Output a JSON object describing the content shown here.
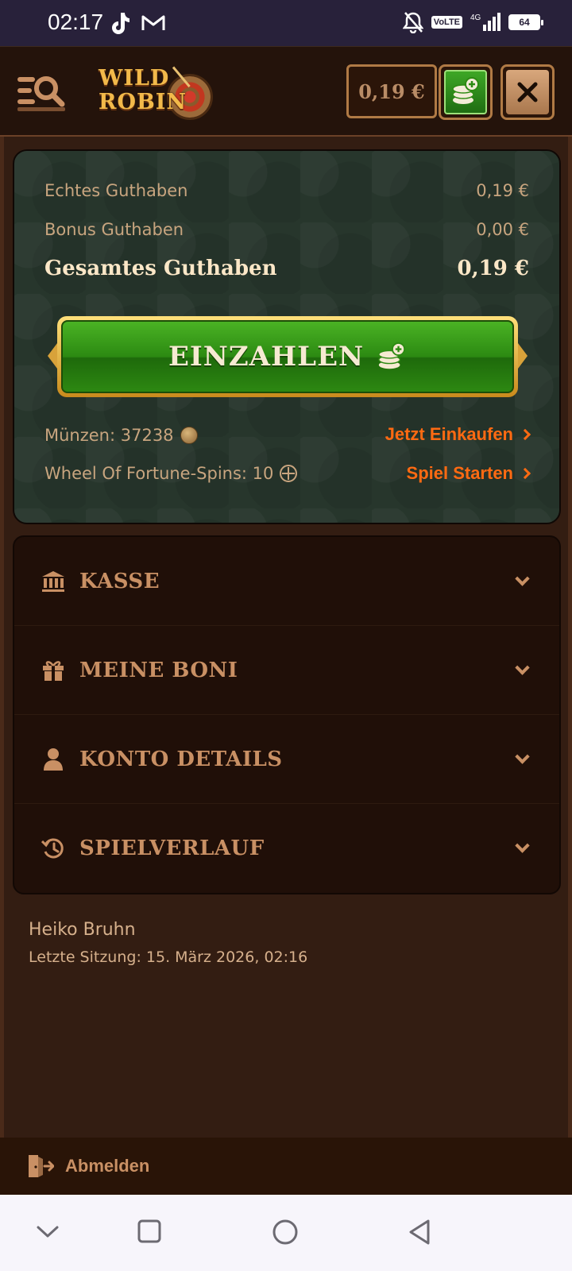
{
  "status_bar": {
    "time": "02:17",
    "battery": "64",
    "network": "VoLTE",
    "signal_label": "4G"
  },
  "header": {
    "logo_line1": "WILD",
    "logo_line2": "ROBIN",
    "balance": "0,19 €"
  },
  "balance_card": {
    "real_label": "Echtes Guthaben",
    "real_value": "0,19 €",
    "bonus_label": "Bonus Guthaben",
    "bonus_value": "0,00 €",
    "total_label": "Gesamtes Guthaben",
    "total_value": "0,19 €",
    "deposit_label": "EINZAHLEN",
    "coins_text": "Münzen: 37238",
    "coins_link": "Jetzt Einkaufen",
    "spins_text": "Wheel Of Fortune-Spins: 10",
    "spins_link": "Spiel Starten"
  },
  "accordion": [
    {
      "label": "KASSE",
      "icon": "bank-icon"
    },
    {
      "label": "MEINE BONI",
      "icon": "gift-icon"
    },
    {
      "label": "KONTO DETAILS",
      "icon": "user-icon"
    },
    {
      "label": "SPIELVERLAUF",
      "icon": "history-icon"
    }
  ],
  "user": {
    "name": "Heiko Bruhn",
    "last_session": "Letzte Sitzung: 15. März 2026, 02:16"
  },
  "logout_label": "Abmelden",
  "colors": {
    "accent_orange": "#ff6a12",
    "deposit_green": "#2c8a12",
    "card_bg": "#27362c",
    "text_tan": "#c99064",
    "annotation_red": "#f0506e"
  }
}
